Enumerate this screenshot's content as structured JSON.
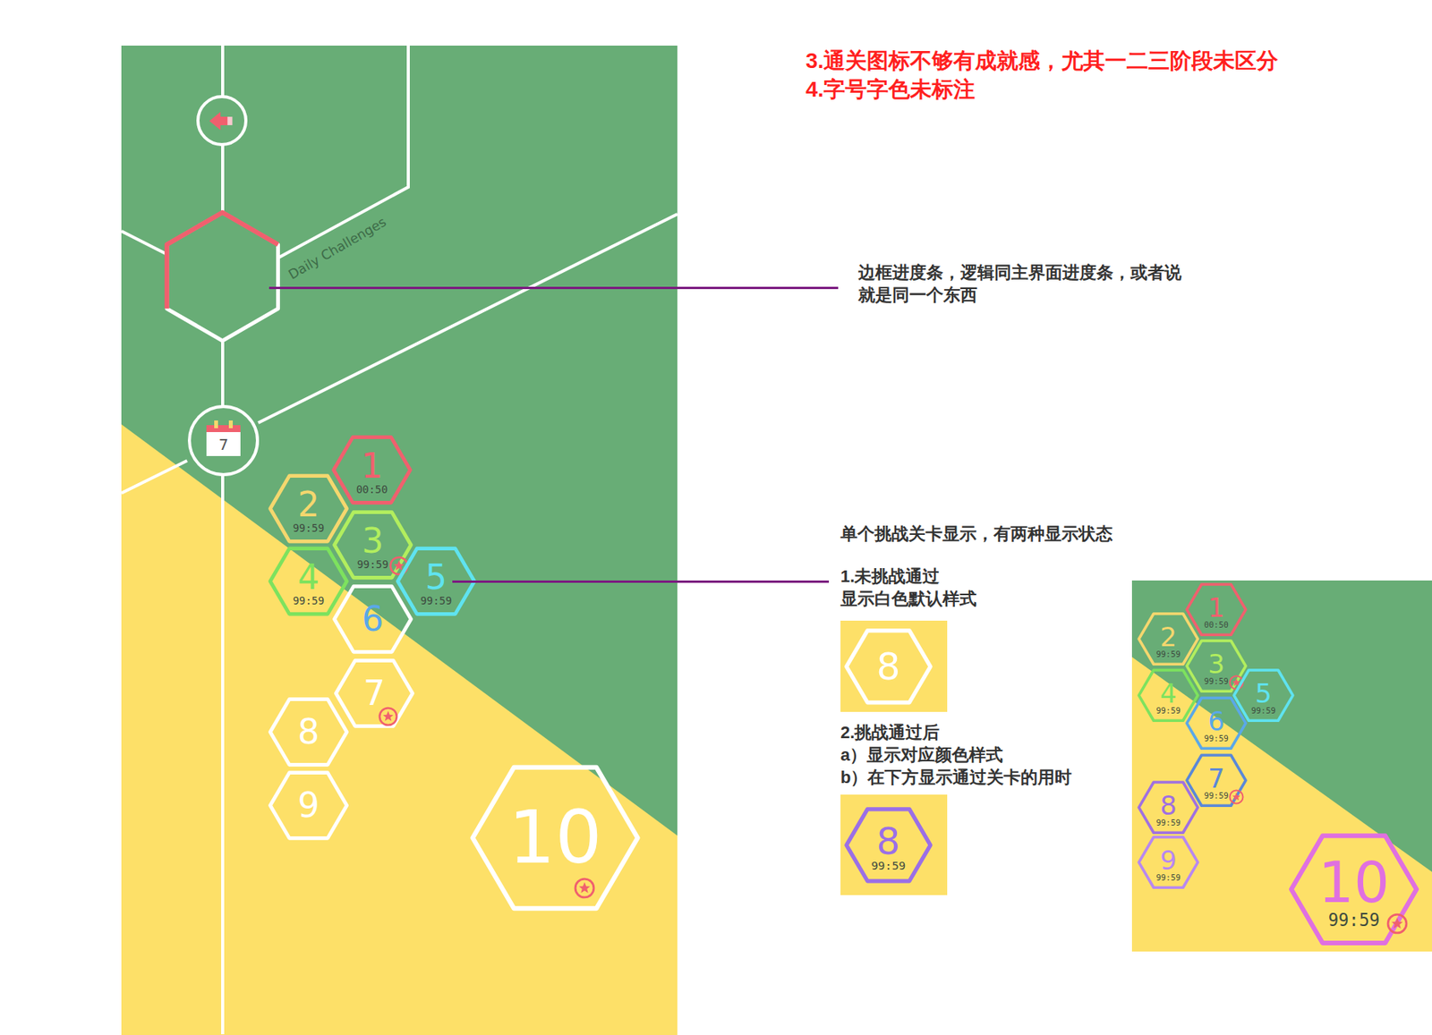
{
  "annotations": {
    "issues": [
      "3.通关图标不够有成就感，尤其一二三阶段未区分",
      "4.字号字色未标注"
    ],
    "progress_note": "边框进度条，逻辑同主界面进度条，或者说就是同一个东西",
    "level_note": {
      "title": "单个挑战关卡显示，有两种显示状态",
      "states": [
        {
          "lines": [
            "1.未挑战通过",
            "显示白色默认样式"
          ],
          "example": {
            "number": "8",
            "time": "",
            "passed": false,
            "color": "#ffffff",
            "number_color": "#ffffff",
            "badge": false
          }
        },
        {
          "lines": [
            "2.挑战通过后",
            "a）显示对应颜色样式",
            "b）在下方显示通过关卡的用时"
          ],
          "example": {
            "number": "8",
            "time": "99:59",
            "passed": true,
            "color": "#9b6fe6",
            "number_color": "#9b6fe6",
            "badge": false
          }
        }
      ]
    }
  },
  "screen": {
    "title": "Daily Challenges",
    "calendar_day": "7",
    "progress_level": 0.5,
    "levels": [
      {
        "number": "1",
        "time": "00:50",
        "passed": true,
        "color": "#f0606e",
        "number_color": "#f0606e",
        "badge": false
      },
      {
        "number": "2",
        "time": "99:59",
        "passed": true,
        "color": "#f5d76e",
        "number_color": "#f5d76e",
        "badge": false
      },
      {
        "number": "3",
        "time": "99:59",
        "passed": true,
        "color": "#b2ee5e",
        "number_color": "#b2ee5e",
        "badge": true
      },
      {
        "number": "4",
        "time": "99:59",
        "passed": true,
        "color": "#7de25e",
        "number_color": "#7de25e",
        "badge": false
      },
      {
        "number": "5",
        "time": "99:59",
        "passed": true,
        "color": "#5fe3f0",
        "number_color": "#5fe3f0",
        "badge": false
      },
      {
        "number": "6",
        "time": "",
        "passed": false,
        "color": "#ffffff",
        "number_color": "#5aa8e8",
        "badge": false
      },
      {
        "number": "7",
        "time": "",
        "passed": false,
        "color": "#ffffff",
        "number_color": "#ffffff",
        "badge": true
      },
      {
        "number": "8",
        "time": "",
        "passed": false,
        "color": "#ffffff",
        "number_color": "#ffffff",
        "badge": false
      },
      {
        "number": "9",
        "time": "",
        "passed": false,
        "color": "#ffffff",
        "number_color": "#ffffff",
        "badge": false
      },
      {
        "number": "10",
        "time": "",
        "passed": false,
        "color": "#ffffff",
        "number_color": "#ffffff",
        "badge": true
      }
    ]
  },
  "preview": {
    "levels": [
      {
        "number": "1",
        "time": "00:50",
        "passed": true,
        "color": "#f0606e",
        "number_color": "#f0606e",
        "badge": false
      },
      {
        "number": "2",
        "time": "99:59",
        "passed": true,
        "color": "#f5d76e",
        "number_color": "#f5d76e",
        "badge": false
      },
      {
        "number": "3",
        "time": "99:59",
        "passed": true,
        "color": "#b2ee5e",
        "number_color": "#b2ee5e",
        "badge": true
      },
      {
        "number": "4",
        "time": "99:59",
        "passed": true,
        "color": "#7de25e",
        "number_color": "#7de25e",
        "badge": false
      },
      {
        "number": "5",
        "time": "99:59",
        "passed": true,
        "color": "#5fe3f0",
        "number_color": "#5fe3f0",
        "badge": false
      },
      {
        "number": "6",
        "time": "99:59",
        "passed": true,
        "color": "#5aa8e8",
        "number_color": "#5aa8e8",
        "badge": false
      },
      {
        "number": "7",
        "time": "99:59",
        "passed": true,
        "color": "#5a88d8",
        "number_color": "#5a88d8",
        "badge": true
      },
      {
        "number": "8",
        "time": "99:59",
        "passed": true,
        "color": "#a070e0",
        "number_color": "#a070e0",
        "badge": false
      },
      {
        "number": "9",
        "time": "99:59",
        "passed": true,
        "color": "#b888f0",
        "number_color": "#b888f0",
        "badge": false
      },
      {
        "number": "10",
        "time": "99:59",
        "passed": true,
        "color": "#e070e0",
        "number_color": "#e070e0",
        "badge": true
      }
    ]
  }
}
